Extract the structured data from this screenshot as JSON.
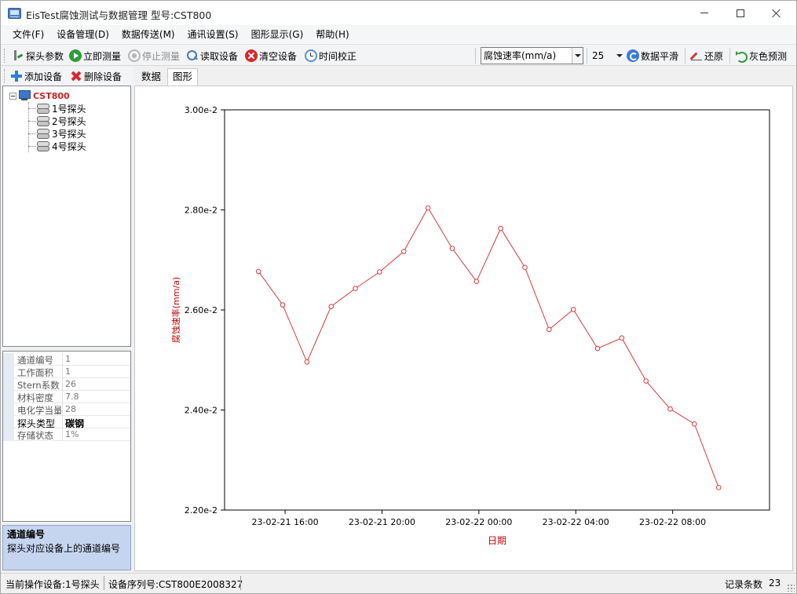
{
  "window": {
    "title": "EisTest腐蚀测试与数据管理  型号:CST800"
  },
  "menu": [
    "文件(F)",
    "设备管理(D)",
    "数据传送(M)",
    "通讯设置(S)",
    "图形显示(G)",
    "帮助(H)"
  ],
  "toolbar": {
    "probe_params": "探头参数",
    "measure_now": "立即测量",
    "stop_measure": "停止测量",
    "read_device": "读取设备",
    "clear_device": "清空设备",
    "time_calibrate": "时间校正",
    "metric_select": "腐蚀速率(mm/a)",
    "smooth_count": "25",
    "data_smooth": "数据平滑",
    "restore": "还原",
    "gray_predict": "灰色预测"
  },
  "left_toolbar": {
    "add_device": "添加设备",
    "delete_device": "删除设备"
  },
  "tabs": {
    "data": "数据",
    "graph": "图形"
  },
  "tree": {
    "root": "CST800",
    "children": [
      "1号探头",
      "2号探头",
      "3号探头",
      "4号探头"
    ]
  },
  "properties": [
    {
      "name": "通道编号",
      "value": "1"
    },
    {
      "name": "工作面积",
      "value": "1"
    },
    {
      "name": "Stern系数",
      "value": "26"
    },
    {
      "name": "材料密度",
      "value": "7.8"
    },
    {
      "name": "电化学当量",
      "value": "28"
    },
    {
      "name": "探头类型",
      "value": "碳钢",
      "strong": true
    },
    {
      "name": "存储状态",
      "value": "1%"
    }
  ],
  "description": {
    "title": "通道编号",
    "text": "探头对应设备上的通道编号"
  },
  "status": {
    "current_device": "当前操作设备:1号探头",
    "serial": "设备序列号:CST800E2008327",
    "record_label": "记录条数",
    "record_count": "23"
  },
  "colors": {
    "series": "#d83a3a",
    "axis_label": "#c00000"
  },
  "chart_data": {
    "type": "line",
    "xlabel": "日期",
    "ylabel": "腐蚀速率(mm/a)",
    "x_ticks": [
      "23-02-21 16:00",
      "23-02-21 20:00",
      "23-02-22 00:00",
      "23-02-22 04:00",
      "23-02-22 08:00"
    ],
    "x_tick_hours": [
      16,
      20,
      24,
      28,
      32
    ],
    "x_range_hours": [
      13.5,
      36.0
    ],
    "y_ticks": [
      "2.20e-2",
      "2.40e-2",
      "2.60e-2",
      "2.80e-2",
      "3.00e-2"
    ],
    "ylim": [
      0.022,
      0.03
    ],
    "series": [
      {
        "x_hours": [
          14.9,
          15.9,
          16.9,
          17.9,
          18.9,
          19.9,
          20.9,
          21.9,
          22.9,
          23.9,
          24.9,
          25.9,
          26.9,
          27.9,
          28.9,
          29.9,
          30.9,
          31.9,
          32.9,
          33.9
        ],
        "values": [
          0.02677,
          0.0261,
          0.02496,
          0.02607,
          0.02643,
          0.02676,
          0.02717,
          0.02804,
          0.02723,
          0.02657,
          0.02763,
          0.02685,
          0.02561,
          0.02601,
          0.02523,
          0.02544,
          0.02458,
          0.02402,
          0.02372,
          0.02245
        ]
      }
    ],
    "grid": false,
    "legend": "none"
  }
}
